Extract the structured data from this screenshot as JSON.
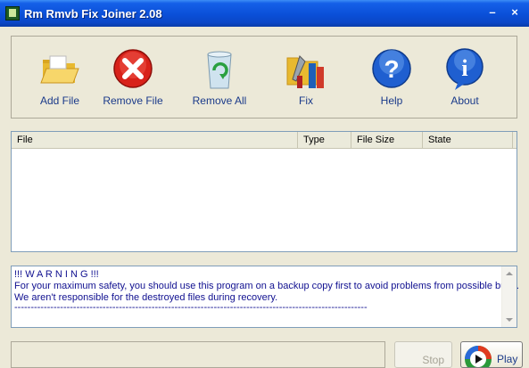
{
  "window": {
    "title": "Rm Rmvb Fix Joiner 2.08",
    "minimize": "–",
    "close": "×"
  },
  "toolbar": {
    "items": [
      {
        "label": "Add File",
        "icon": "folder-open-icon"
      },
      {
        "label": "Remove File",
        "icon": "red-x-icon"
      },
      {
        "label": "Remove All",
        "icon": "recycle-bin-icon"
      },
      {
        "label": "Fix",
        "icon": "tools-icon"
      },
      {
        "label": "Help",
        "icon": "question-icon"
      },
      {
        "label": "About",
        "icon": "info-icon"
      }
    ]
  },
  "file_list": {
    "columns": [
      "File",
      "Type",
      "File Size",
      "State"
    ],
    "rows": []
  },
  "log": {
    "lines": [
      "!!! W A R N I N G !!!",
      "For your maximum safety, you should use this program on a backup copy first to avoid problems from possible bugs.",
      "We aren't responsible for the destroyed files during recovery.",
      "------------------------------------------------------------------------------------------------------------"
    ]
  },
  "controls": {
    "stop_label": "Stop",
    "play_label": "Play"
  },
  "colors": {
    "titlebar": "#0a4fd8",
    "window_bg": "#ece9d8",
    "label_text": "#1a3a8a"
  }
}
